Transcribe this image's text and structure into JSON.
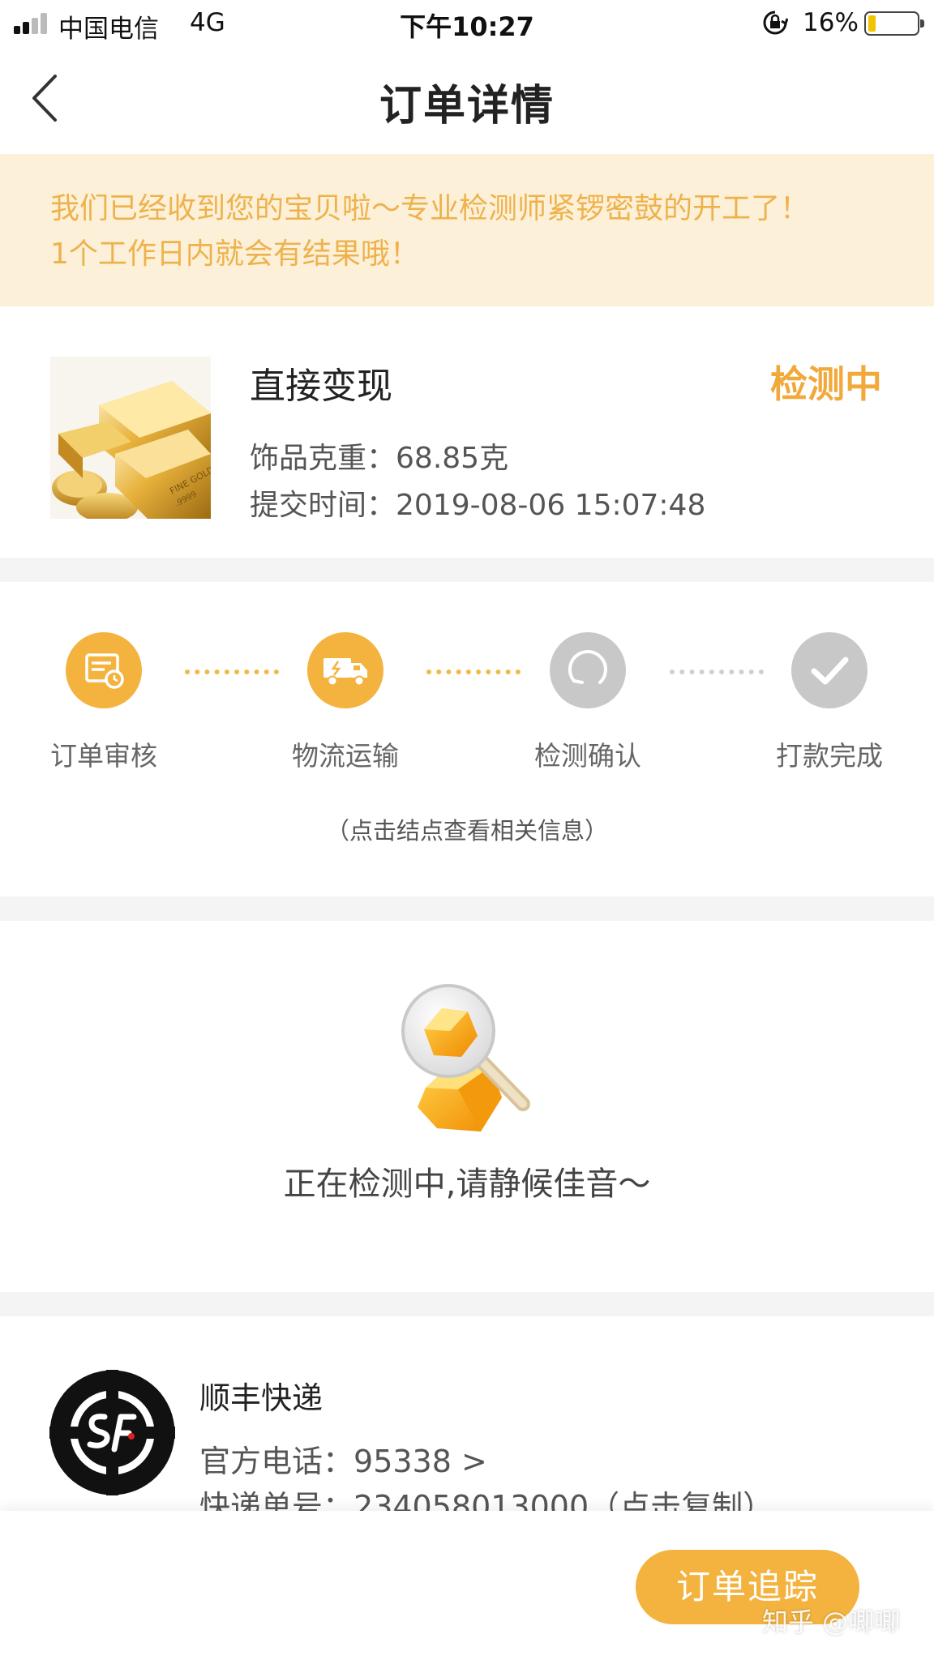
{
  "status_bar": {
    "carrier": "中国电信",
    "network": "4G",
    "time": "下午10:27",
    "battery": "16%",
    "battery_level": 0.16
  },
  "nav": {
    "title": "订单详情",
    "back_icon": "chevron-left-icon"
  },
  "notice": {
    "line1": "我们已经收到您的宝贝啦～专业检测师紧锣密鼓的开工了！",
    "line2": "1个工作日内就会有结果哦！"
  },
  "product": {
    "name": "直接变现",
    "status": "检测中",
    "weight_label": "饰品克重：",
    "weight_value": "68.85克",
    "time_label": "提交时间：",
    "time_value": "2019-08-06 15:07:48"
  },
  "steps": {
    "items": [
      {
        "label": "订单审核",
        "icon": "order-review-icon",
        "state": "done"
      },
      {
        "label": "物流运输",
        "icon": "truck-icon",
        "state": "done"
      },
      {
        "label": "检测确认",
        "icon": "inspect-icon",
        "state": "pending"
      },
      {
        "label": "打款完成",
        "icon": "check-icon",
        "state": "pending"
      }
    ],
    "hint": "（点击结点查看相关信息）"
  },
  "detect": {
    "text": "正在检测中,请静候佳音～"
  },
  "courier": {
    "name": "顺丰快递",
    "phone_label": "官方电话：",
    "phone_value": "95338 >",
    "track_label": "快递单号：",
    "track_value": "234058013000（点击复制）"
  },
  "bottom": {
    "track_button": "订单追踪",
    "watermark": "知乎 @唧唧"
  },
  "colors": {
    "accent": "#f3b33e",
    "notice_bg": "#fdf0d9",
    "notice_text": "#eeb24c",
    "pending_grey": "#c8c8c8"
  }
}
